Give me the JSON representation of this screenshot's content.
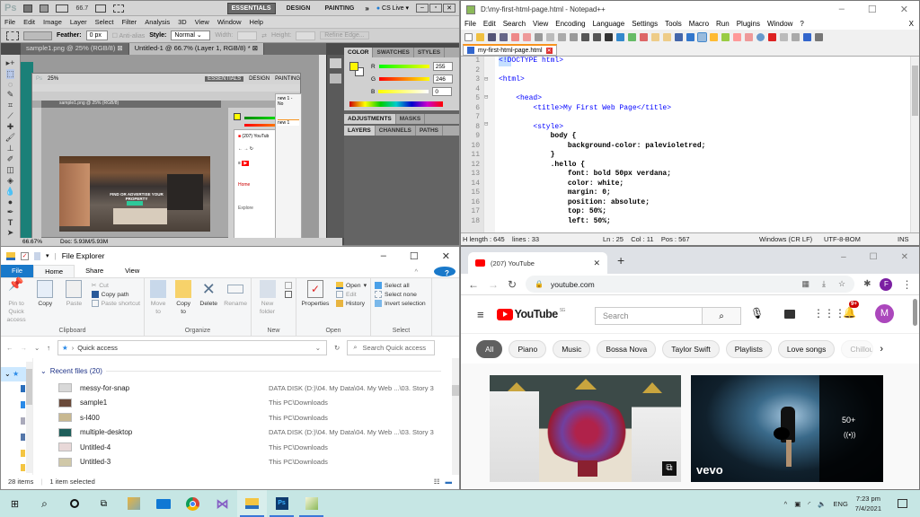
{
  "photoshop": {
    "logo": "Ps",
    "zoom_level": "66.7",
    "workspaces": [
      "ESSENTIALS",
      "DESIGN",
      "PAINTING"
    ],
    "cs_live": "CS Live",
    "menu": [
      "File",
      "Edit",
      "Image",
      "Layer",
      "Select",
      "Filter",
      "Analysis",
      "3D",
      "View",
      "Window",
      "Help"
    ],
    "options": {
      "feather_label": "Feather:",
      "feather_value": "0 px",
      "antialias_label": "Anti-alias",
      "style_label": "Style:",
      "style_value": "Normal",
      "width_label": "Width:",
      "height_label": "Height:",
      "refine_edge": "Refine Edge..."
    },
    "doc_tabs": [
      "sample1.png @ 25% (RGB/8)",
      "Untitled-1 @ 66.7% (Layer 1, RGB/8) *"
    ],
    "status_zoom": "66.67%",
    "status_doc": "Doc: 5.93M/5.93M",
    "color_panel": {
      "tabs": [
        "COLOR",
        "SWATCHES",
        "STYLES"
      ],
      "channels": [
        {
          "label": "R",
          "value": "255"
        },
        {
          "label": "G",
          "value": "246"
        },
        {
          "label": "B",
          "value": "0"
        }
      ],
      "foreground": "#fff600"
    },
    "adjust_tabs": [
      "ADJUSTMENTS",
      "MASKS"
    ],
    "layer_tabs": [
      "LAYERS",
      "CHANNELS",
      "PATHS"
    ],
    "nested": {
      "doc_tab": "sample1.png @ 25% (RGB/8)",
      "zoom": "25%",
      "image_caption": "FIND OR ADVERTISE YOUR PROPERTY",
      "notepad_title": "new 1 - No",
      "notepad_tab": "new 1",
      "youtube_tab": "(207) YouTub",
      "home_label": "Home",
      "explore_label": "Explore"
    }
  },
  "notepad": {
    "title": "D:\\my-first-html-page.html - Notepad++",
    "menu": [
      "File",
      "Edit",
      "Search",
      "View",
      "Encoding",
      "Language",
      "Settings",
      "Tools",
      "Macro",
      "Run",
      "Plugins",
      "Window",
      "?"
    ],
    "close_doc": "X",
    "tab": "my-first-html-page.html",
    "lines": [
      "<!DOCTYPE html>",
      "",
      "<html>",
      "",
      "    <head>",
      "        <title>My First Web Page</title>",
      "",
      "        <style>",
      "            body {",
      "                background-color: palevioletred;",
      "            }",
      "            .hello {",
      "                font: bold 50px verdana;",
      "                color: white;",
      "                margin: 0;",
      "                position: absolute;",
      "                top: 50%;",
      "                left: 50%;"
    ],
    "status": {
      "length": "H length : 645    lines : 33",
      "position": "Ln : 25    Col : 11    Pos : 567",
      "eol": "Windows (CR LF)",
      "encoding": "UTF-8-BOM",
      "mode": "INS"
    }
  },
  "explorer": {
    "title": "File Explorer",
    "ribbon_tabs": [
      "File",
      "Home",
      "Share",
      "View"
    ],
    "clipboard": {
      "pin": "Pin to Quick access",
      "copy": "Copy",
      "paste": "Paste",
      "cut": "Cut",
      "copy_path": "Copy path",
      "paste_shortcut": "Paste shortcut",
      "group": "Clipboard"
    },
    "organize": {
      "move_to": "Move to",
      "copy_to": "Copy to",
      "delete": "Delete",
      "rename": "Rename",
      "group": "Organize"
    },
    "new": {
      "new_folder": "New folder",
      "group": "New"
    },
    "open": {
      "properties": "Properties",
      "open": "Open",
      "edit": "Edit",
      "history": "History",
      "group": "Open"
    },
    "select": {
      "select_all": "Select all",
      "select_none": "Select none",
      "invert": "Invert selection",
      "group": "Select"
    },
    "address": "Quick access",
    "search_placeholder": "Search Quick access",
    "section": "Recent files (20)",
    "files": [
      {
        "name": "messy-for-snap",
        "location": "DATA DISK (D:)\\04.  My Data\\04.  My Web ...\\03.  Story 3",
        "thumb": "#d8d8d8"
      },
      {
        "name": "sample1",
        "location": "This PC\\Downloads",
        "thumb": "#6a4a3a"
      },
      {
        "name": "s-l400",
        "location": "This PC\\Downloads",
        "thumb": "#c8b890"
      },
      {
        "name": "multiple-desktop",
        "location": "DATA DISK (D:)\\04.  My Data\\04.  My Web ...\\03.  Story 3",
        "thumb": "#1e5e5a"
      },
      {
        "name": "Untitled-4",
        "location": "This PC\\Downloads",
        "thumb": "#e8d8d8"
      },
      {
        "name": "Untitled-3",
        "location": "This PC\\Downloads",
        "thumb": "#d0c8a8"
      }
    ],
    "status_items": "28 items",
    "status_selected": "1 item selected"
  },
  "chrome": {
    "tab_title": "(207) YouTube",
    "url": "youtube.com",
    "profile_initial": "F",
    "youtube": {
      "logo_text": "YouTube",
      "country": "SG",
      "search_placeholder": "Search",
      "notifications": "9+",
      "avatar_initial": "M",
      "chips": [
        "All",
        "Piano",
        "Music",
        "Bossa Nova",
        "Taylor Swift",
        "Playlists",
        "Love songs",
        "Chillout music"
      ],
      "playlist_count": "50+",
      "vevo": "vevo"
    }
  },
  "taskbar": {
    "apps": [
      "start",
      "search",
      "cortana",
      "task-view",
      "tools",
      "mail",
      "chrome",
      "visual-studio",
      "file-explorer",
      "photoshop",
      "notepad-plus-plus"
    ],
    "language": "ENG",
    "time": "7:23 pm",
    "date": "7/4/2021"
  }
}
